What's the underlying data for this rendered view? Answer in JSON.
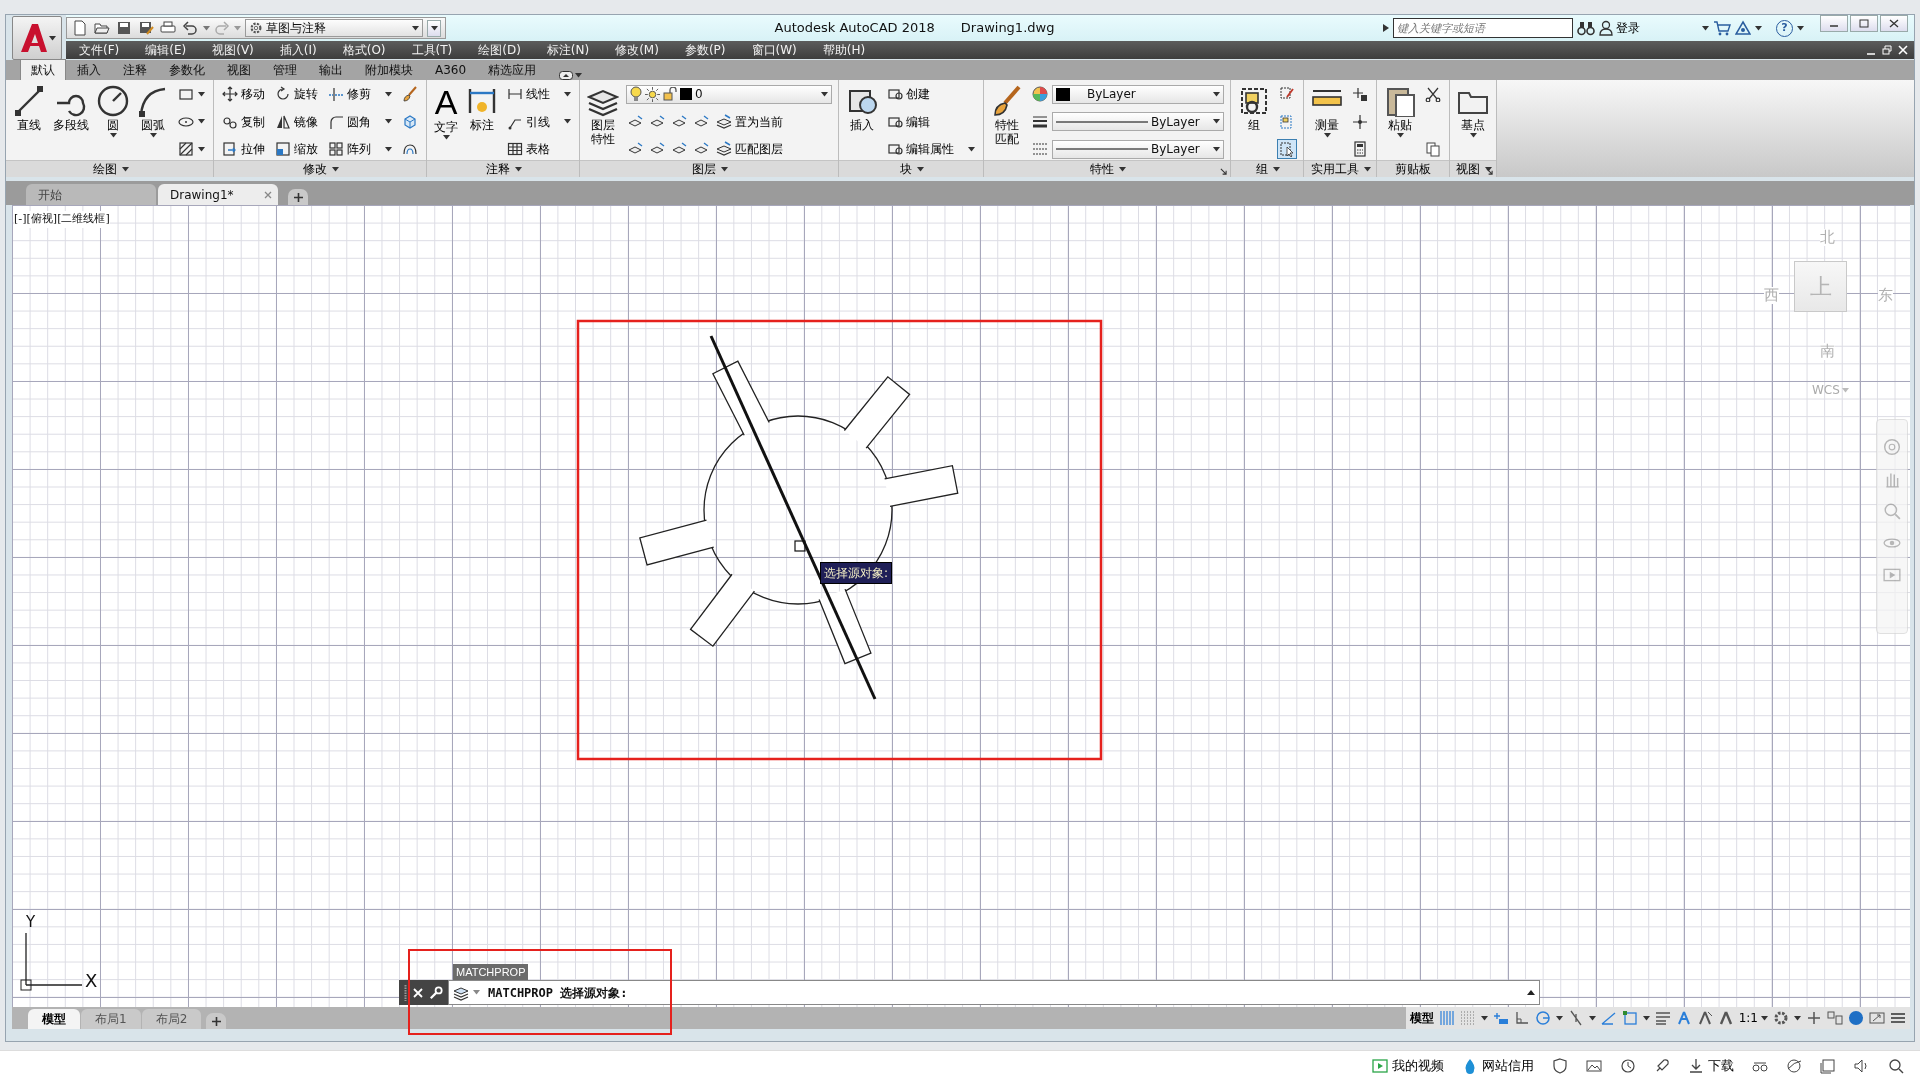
{
  "title_bar": {
    "workspace": "草图与注释",
    "app_title": "Autodesk AutoCAD 2018",
    "file_title": "Drawing1.dwg",
    "search": {
      "placeholder": "键入关键字或短语"
    },
    "sign_in": "登录",
    "help": "?"
  },
  "menu": [
    "文件(F)",
    "编辑(E)",
    "视图(V)",
    "插入(I)",
    "格式(O)",
    "工具(T)",
    "绘图(D)",
    "标注(N)",
    "修改(M)",
    "参数(P)",
    "窗口(W)",
    "帮助(H)"
  ],
  "ribbon_tabs": [
    {
      "label": "默认",
      "selected": true
    },
    {
      "label": "插入",
      "selected": false
    },
    {
      "label": "注释",
      "selected": false
    },
    {
      "label": "参数化",
      "selected": false
    },
    {
      "label": "视图",
      "selected": false
    },
    {
      "label": "管理",
      "selected": false
    },
    {
      "label": "输出",
      "selected": false
    },
    {
      "label": "附加模块",
      "selected": false
    },
    {
      "label": "A360",
      "selected": false
    },
    {
      "label": "精选应用",
      "selected": false
    }
  ],
  "ribbon_panels": [
    {
      "label": "绘图",
      "columns": [
        [
          [
            {
              "kind": "large",
              "label": "直线"
            }
          ]
        ],
        [
          [
            {
              "kind": "large",
              "label": "多段线"
            }
          ]
        ],
        [
          [
            {
              "kind": "large",
              "label": "圆",
              "caret": true
            }
          ]
        ],
        [
          [
            {
              "kind": "large",
              "label": "圆弧",
              "caret": true
            }
          ]
        ],
        [
          [
            {
              "kind": "icon",
              "caret": true
            }
          ],
          [
            {
              "kind": "icon",
              "caret": true
            }
          ],
          [
            {
              "kind": "icon",
              "caret": true
            }
          ]
        ]
      ]
    },
    {
      "label": "修改",
      "columns": [
        [
          [
            {
              "kind": "small",
              "label": "移动"
            }
          ],
          [
            {
              "kind": "small",
              "label": "复制"
            }
          ],
          [
            {
              "kind": "small",
              "label": "拉伸"
            }
          ]
        ],
        [
          [
            {
              "kind": "small",
              "label": "旋转"
            }
          ],
          [
            {
              "kind": "small",
              "label": "镜像"
            }
          ],
          [
            {
              "kind": "small",
              "label": "缩放"
            }
          ]
        ],
        [
          [
            {
              "kind": "small",
              "label": "修剪",
              "caret": true
            }
          ],
          [
            {
              "kind": "small",
              "label": "圆角",
              "caret": true
            }
          ],
          [
            {
              "kind": "small",
              "label": "阵列",
              "caret": true
            }
          ]
        ],
        [
          [
            {
              "kind": "icon"
            }
          ],
          [
            {
              "kind": "icon"
            }
          ],
          [
            {
              "kind": "icon"
            }
          ]
        ]
      ]
    },
    {
      "label": "注释",
      "columns": [
        [
          [
            {
              "kind": "large",
              "label": "文字",
              "glyph": "A",
              "caret": true
            }
          ]
        ],
        [
          [
            {
              "kind": "large",
              "label": "标注"
            }
          ]
        ],
        [
          [
            {
              "kind": "small",
              "label": "线性",
              "caret": true
            }
          ],
          [
            {
              "kind": "small",
              "label": "引线",
              "caret": true
            }
          ],
          [
            {
              "kind": "small",
              "label": "表格"
            }
          ]
        ]
      ]
    },
    {
      "label": "图层",
      "columns": [
        [
          [
            {
              "kind": "large",
              "label": "图层特性"
            }
          ]
        ],
        [
          [
            {
              "kind": "layer_combo",
              "value": "0"
            }
          ],
          [
            {
              "kind": "icon"
            },
            {
              "kind": "icon"
            },
            {
              "kind": "icon"
            },
            {
              "kind": "icon"
            },
            {
              "kind": "small",
              "label": "置为当前"
            }
          ],
          [
            {
              "kind": "icon"
            },
            {
              "kind": "icon"
            },
            {
              "kind": "icon"
            },
            {
              "kind": "icon"
            },
            {
              "kind": "small",
              "label": "匹配图层"
            }
          ]
        ]
      ]
    },
    {
      "label": "块",
      "columns": [
        [
          [
            {
              "kind": "large",
              "label": "插入"
            }
          ]
        ],
        [
          [
            {
              "kind": "small",
              "label": "创建"
            }
          ],
          [
            {
              "kind": "small",
              "label": "编辑"
            }
          ],
          [
            {
              "kind": "small",
              "label": "编辑属性",
              "caret": true
            }
          ]
        ]
      ]
    },
    {
      "label": "特性",
      "launcher": true,
      "columns": [
        [
          [
            {
              "kind": "large",
              "label": "特性匹配"
            }
          ]
        ],
        [
          [
            {
              "kind": "icon"
            },
            {
              "kind": "combo",
              "value": "ByLayer"
            }
          ],
          [
            {
              "kind": "icon"
            },
            {
              "kind": "combo",
              "value": "ByLayer"
            }
          ],
          [
            {
              "kind": "icon"
            },
            {
              "kind": "combo",
              "value": "ByLayer"
            }
          ]
        ]
      ]
    },
    {
      "label": "组",
      "columns": [
        [
          [
            {
              "kind": "large",
              "label": "组"
            }
          ]
        ],
        [
          [
            {
              "kind": "icon"
            }
          ],
          [
            {
              "kind": "icon"
            }
          ],
          [
            {
              "kind": "icon",
              "on": true
            }
          ]
        ]
      ]
    },
    {
      "label": "实用工具",
      "columns": [
        [
          [
            {
              "kind": "large",
              "label": "测量",
              "caret": true
            }
          ]
        ],
        [
          [
            {
              "kind": "icon"
            }
          ],
          [
            {
              "kind": "icon"
            }
          ],
          [
            {
              "kind": "icon"
            }
          ]
        ]
      ]
    },
    {
      "label": "剪贴板",
      "columns": [
        [
          [
            {
              "kind": "large",
              "label": "粘贴",
              "caret": true
            }
          ]
        ],
        [
          [
            {
              "kind": "icon"
            }
          ],
          [
            {
              "kind": "icon"
            }
          ]
        ]
      ]
    },
    {
      "label": "视图",
      "launcher": true,
      "columns": [
        [
          [
            {
              "kind": "large",
              "label": "基点",
              "caret": true
            }
          ]
        ]
      ]
    }
  ],
  "file_tabs": [
    {
      "label": "开始",
      "selected": false
    },
    {
      "label": "Drawing1*",
      "selected": true,
      "closable": true
    }
  ],
  "viewport_label": "[-][俯视][二维线框]",
  "viewcube": {
    "north": "北",
    "west": "西",
    "east": "东",
    "south": "南",
    "top": "上",
    "ucs": "WCS"
  },
  "ucs_axes": {
    "y": "Y",
    "x": "X"
  },
  "tooltip": "选择源对象:",
  "command_line": {
    "recent": "MATCHPROP",
    "prompt": "MATCHPROP 选择源对象:"
  },
  "layout_tabs": [
    {
      "label": "模型",
      "selected": true
    },
    {
      "label": "布局1",
      "selected": false
    },
    {
      "label": "布局2",
      "selected": false
    }
  ],
  "status_bar": {
    "model": "模型",
    "scale": "1:1"
  },
  "browser_bar": {
    "videos": "我的视频",
    "credit": "网站信用",
    "download": "下载"
  }
}
